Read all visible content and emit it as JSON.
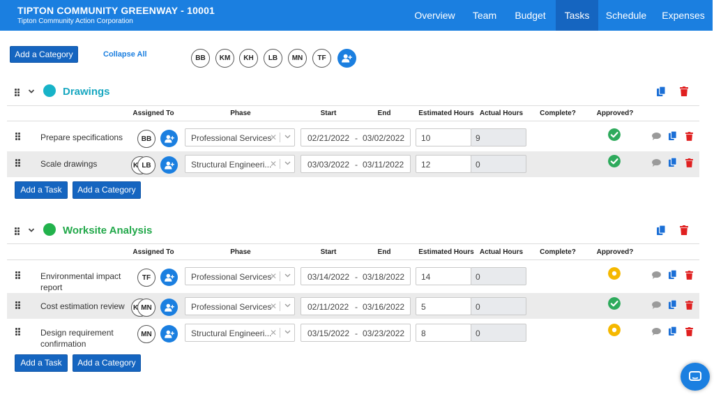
{
  "header": {
    "project_title": "TIPTON COMMUNITY GREENWAY - 10001",
    "organization": "Tipton Community Action Corporation",
    "nav": [
      "Overview",
      "Team",
      "Budget",
      "Tasks",
      "Schedule",
      "Expenses"
    ],
    "active_tab": "Tasks"
  },
  "toolbar": {
    "add_category": "Add a Category",
    "collapse_all": "Collapse All",
    "team": [
      "BB",
      "KM",
      "KH",
      "LB",
      "MN",
      "TF"
    ]
  },
  "columns": {
    "assigned_to": "Assigned To",
    "phase": "Phase",
    "start": "Start",
    "end": "End",
    "estimated_hours": "Estimated Hours",
    "actual_hours": "Actual Hours",
    "complete": "Complete?",
    "approved": "Approved?"
  },
  "date_separator": "-",
  "colors": {
    "brand": "#1b7fe0",
    "active_nav": "#1565c0",
    "approved": "#2eaa5c",
    "pending": "#f5b800",
    "delete": "#e02020"
  },
  "categories": [
    {
      "name": "Drawings",
      "color": "#17b3c8",
      "add_task": "Add a Task",
      "add_category": "Add a Category",
      "tasks": [
        {
          "name": "Prepare specifications",
          "assignees": [
            "BB"
          ],
          "phase": "Professional Services",
          "start": "02/21/2022",
          "end": "03/02/2022",
          "estimated_hours": "10",
          "actual_hours": "9",
          "approved": "approved"
        },
        {
          "name": "Scale drawings",
          "assignees": [
            "K",
            "LB"
          ],
          "phase": "Structural Engineeri...",
          "start": "03/03/2022",
          "end": "03/11/2022",
          "estimated_hours": "12",
          "actual_hours": "0",
          "approved": "approved"
        }
      ]
    },
    {
      "name": "Worksite Analysis",
      "color": "#22b24c",
      "add_task": "Add a Task",
      "add_category": "Add a Category",
      "tasks": [
        {
          "name_line1": "Environmental impact",
          "name_line2": "report",
          "assignees": [
            "TF"
          ],
          "phase": "Professional Services",
          "start": "03/14/2022",
          "end": "03/18/2022",
          "estimated_hours": "14",
          "actual_hours": "0",
          "approved": "pending"
        },
        {
          "name": "Cost estimation review",
          "assignees": [
            "K",
            "MN"
          ],
          "phase": "Professional Services",
          "start": "02/11/2022",
          "end": "03/16/2022",
          "estimated_hours": "5",
          "actual_hours": "0",
          "approved": "approved"
        },
        {
          "name_line1": "Design requirement",
          "name_line2": "confirmation",
          "assignees": [
            "MN"
          ],
          "phase": "Structural Engineeri...",
          "start": "03/15/2022",
          "end": "03/23/2022",
          "estimated_hours": "8",
          "actual_hours": "0",
          "approved": "pending"
        }
      ]
    }
  ]
}
